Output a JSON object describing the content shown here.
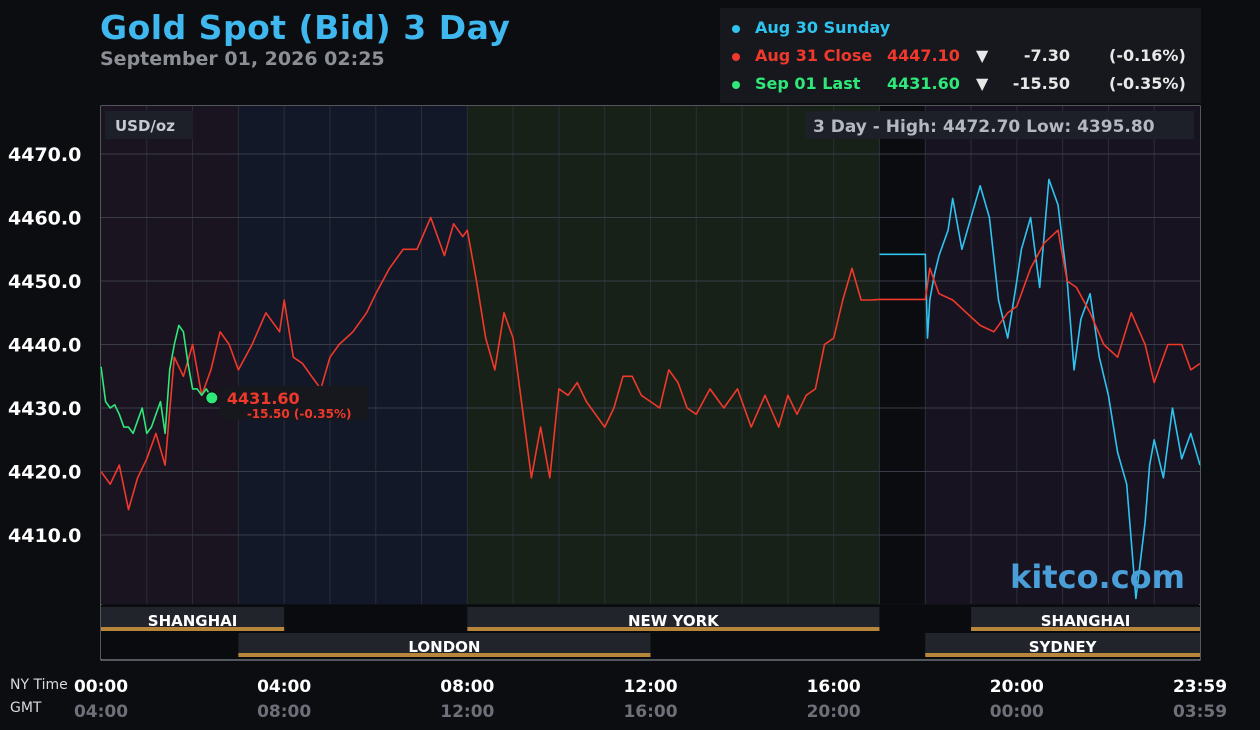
{
  "header": {
    "title": "Gold Spot (Bid) 3 Day",
    "subtitle": "September 01, 2026 02:25"
  },
  "legend": [
    {
      "name": "Aug 30 Sunday",
      "price": "",
      "arrow": "",
      "change": "",
      "pct": "",
      "color": "#2ec4f0"
    },
    {
      "name": "Aug 31 Close",
      "price": "4447.10",
      "arrow": "▼",
      "change": "-7.30",
      "pct": "(-0.16%)",
      "color": "#f0392b"
    },
    {
      "name": "Sep 01 Last",
      "price": "4431.60",
      "arrow": "▼",
      "change": "-15.50",
      "pct": "(-0.35%)",
      "color": "#2fe87a"
    }
  ],
  "plot": {
    "unit": "USD/oz",
    "high_low": "3 Day - High: 4472.70  Low: 4395.80",
    "watermark": "kitco.com",
    "current_label": "4431.60",
    "current_change": "-15.50 (-0.35%)"
  },
  "sessions": [
    {
      "name": "SHANGHAI",
      "start": 0.0,
      "end": 4.0,
      "row": 1
    },
    {
      "name": "NEW YORK",
      "start": 8.0,
      "end": 17.0,
      "row": 1
    },
    {
      "name": "SHANGHAI",
      "start": 19.0,
      "end": 24.0,
      "row": 1
    },
    {
      "name": "LONDON",
      "start": 3.0,
      "end": 12.0,
      "row": 2
    },
    {
      "name": "SYDNEY",
      "start": 18.0,
      "end": 24.0,
      "row": 2
    }
  ],
  "time_axis": {
    "ny_label": "NY Time",
    "gmt_label": "GMT",
    "ny_ticks": [
      "00:00",
      "04:00",
      "08:00",
      "12:00",
      "16:00",
      "20:00",
      "23:59"
    ],
    "gmt_ticks": [
      "04:00",
      "08:00",
      "12:00",
      "16:00",
      "20:00",
      "00:00",
      "03:59"
    ]
  },
  "colors": {
    "sunday": "#2ec4f0",
    "aug31": "#f0392b",
    "sep01": "#2fe87a",
    "session_bar": "#b8863a"
  },
  "chart_data": {
    "type": "line",
    "title": "Gold Spot (Bid) 3 Day",
    "ylabel": "USD/oz",
    "xlabel": "NY Time",
    "x_unit": "hours (NY Time)",
    "xlim": [
      0,
      24
    ],
    "ylim": [
      4397,
      4473
    ],
    "yticks": [
      4410.0,
      4420.0,
      4430.0,
      4440.0,
      4450.0,
      4460.0,
      4470.0
    ],
    "grid": true,
    "series": [
      {
        "name": "Aug 30 Sunday",
        "x": [
          17.0,
          18.0,
          18.05,
          18.1,
          18.2,
          18.3,
          18.5,
          18.6,
          18.8,
          19.0,
          19.2,
          19.4,
          19.6,
          19.8,
          20.0,
          20.1,
          20.3,
          20.5,
          20.7,
          20.9,
          21.1,
          21.25,
          21.4,
          21.6,
          21.8,
          22.0,
          22.2,
          22.4,
          22.6,
          22.8,
          22.9,
          23.0,
          23.2,
          23.4,
          23.6,
          23.8,
          24.0
        ],
        "y": [
          4454.2,
          4454.2,
          4441.0,
          4447.0,
          4451.0,
          4454.0,
          4458.0,
          4463.0,
          4455.0,
          4460.0,
          4465.0,
          4460.0,
          4447.0,
          4441.0,
          4450.0,
          4455.0,
          4460.0,
          4449.0,
          4466.0,
          4462.0,
          4450.0,
          4436.0,
          4444.0,
          4448.0,
          4438.0,
          4432.0,
          4423.0,
          4418.0,
          4400.0,
          4412.0,
          4421.0,
          4425.0,
          4419.0,
          4430.0,
          4422.0,
          4426.0,
          4421.0
        ]
      },
      {
        "name": "Aug 31 Close",
        "x": [
          0.0,
          0.2,
          0.4,
          0.6,
          0.8,
          1.0,
          1.2,
          1.4,
          1.6,
          1.8,
          2.0,
          2.2,
          2.4,
          2.6,
          2.8,
          3.0,
          3.3,
          3.6,
          3.9,
          4.0,
          4.2,
          4.4,
          4.6,
          4.8,
          5.0,
          5.2,
          5.5,
          5.8,
          6.0,
          6.3,
          6.6,
          6.9,
          7.2,
          7.5,
          7.7,
          7.9,
          8.0,
          8.2,
          8.4,
          8.6,
          8.8,
          9.0,
          9.2,
          9.4,
          9.6,
          9.8,
          10.0,
          10.2,
          10.4,
          10.6,
          10.8,
          11.0,
          11.2,
          11.4,
          11.6,
          11.8,
          12.0,
          12.2,
          12.4,
          12.6,
          12.8,
          13.0,
          13.3,
          13.6,
          13.9,
          14.2,
          14.5,
          14.8,
          15.0,
          15.2,
          15.4,
          15.6,
          15.8,
          16.0,
          16.2,
          16.4,
          16.6,
          16.8,
          17.0,
          18.0,
          18.1,
          18.3,
          18.6,
          18.9,
          19.2,
          19.5,
          19.8,
          20.0,
          20.3,
          20.6,
          20.9,
          21.1,
          21.3,
          21.6,
          21.9,
          22.2,
          22.5,
          22.8,
          23.0,
          23.3,
          23.6,
          23.8,
          24.0
        ],
        "y": [
          4420.0,
          4418.0,
          4421.0,
          4414.0,
          4419.0,
          4422.0,
          4426.0,
          4421.0,
          4438.0,
          4435.0,
          4440.0,
          4432.0,
          4436.0,
          4442.0,
          4440.0,
          4436.0,
          4440.0,
          4445.0,
          4442.0,
          4447.0,
          4438.0,
          4437.0,
          4435.0,
          4433.0,
          4438.0,
          4440.0,
          4442.0,
          4445.0,
          4448.0,
          4452.0,
          4455.0,
          4455.0,
          4460.0,
          4454.0,
          4459.0,
          4457.0,
          4458.0,
          4450.0,
          4441.0,
          4436.0,
          4445.0,
          4441.0,
          4430.0,
          4419.0,
          4427.0,
          4419.0,
          4433.0,
          4432.0,
          4434.0,
          4431.0,
          4429.0,
          4427.0,
          4430.0,
          4435.0,
          4435.0,
          4432.0,
          4431.0,
          4430.0,
          4436.0,
          4434.0,
          4430.0,
          4429.0,
          4433.0,
          4430.0,
          4433.0,
          4427.0,
          4432.0,
          4427.0,
          4432.0,
          4429.0,
          4432.0,
          4433.0,
          4440.0,
          4441.0,
          4447.0,
          4452.0,
          4447.0,
          4447.0,
          4447.1,
          4447.1,
          4452.0,
          4448.0,
          4447.0,
          4445.0,
          4443.0,
          4442.0,
          4445.0,
          4446.0,
          4452.0,
          4456.0,
          4458.0,
          4450.0,
          4449.0,
          4445.0,
          4440.0,
          4438.0,
          4445.0,
          4440.0,
          4434.0,
          4440.0,
          4440.0,
          4436.0,
          4437.0
        ]
      },
      {
        "name": "Sep 01 Last",
        "x": [
          0.0,
          0.1,
          0.2,
          0.3,
          0.4,
          0.5,
          0.6,
          0.7,
          0.8,
          0.9,
          1.0,
          1.1,
          1.2,
          1.3,
          1.4,
          1.5,
          1.6,
          1.7,
          1.8,
          1.9,
          2.0,
          2.1,
          2.2,
          2.3,
          2.42
        ],
        "y": [
          4436.5,
          4431.0,
          4430.0,
          4430.5,
          4429.0,
          4427.0,
          4427.0,
          4426.0,
          4428.0,
          4430.0,
          4426.0,
          4427.0,
          4429.0,
          4431.0,
          4426.0,
          4436.0,
          4440.0,
          4443.0,
          4442.0,
          4437.0,
          4433.0,
          4433.0,
          4432.0,
          4433.0,
          4431.6
        ]
      }
    ]
  }
}
